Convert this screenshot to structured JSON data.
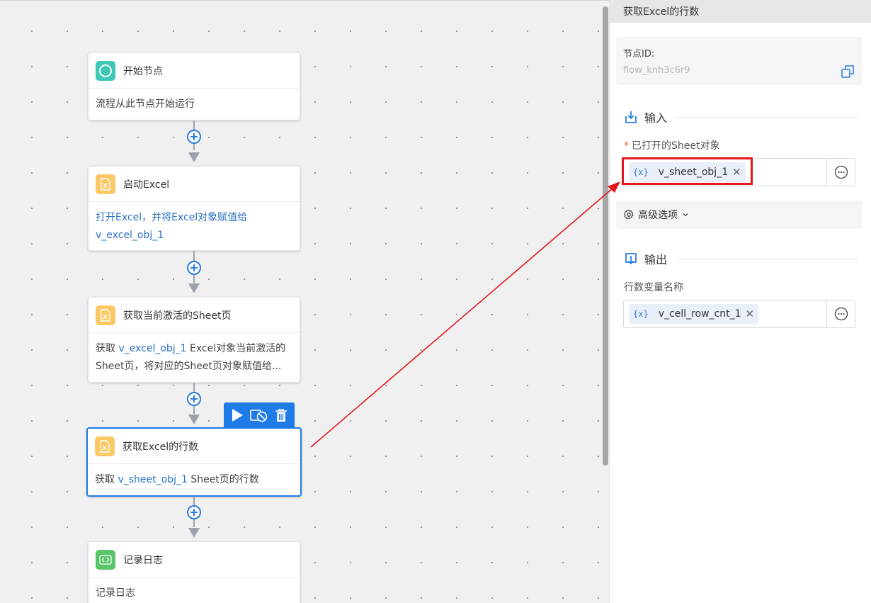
{
  "canvas": {
    "nodes": [
      {
        "title": "开始节点",
        "body_text": "流程从此节点开始运行"
      },
      {
        "title": "启动Excel",
        "body_prefix": "打开Excel，并将Excel对象赋值给",
        "body_var": "v_excel_obj_1"
      },
      {
        "title": "获取当前激活的Sheet页",
        "body_prefix": "获取 ",
        "body_var": "v_excel_obj_1",
        "body_suffix": " Excel对象当前激活的",
        "body_line2": "Sheet页，将对应的Sheet页对象赋值给..."
      },
      {
        "title": "获取Excel的行数",
        "body_prefix": "获取 ",
        "body_var": "v_sheet_obj_1",
        "body_suffix": " Sheet页的行数"
      },
      {
        "title": "记录日志",
        "body_text": "记录日志"
      }
    ],
    "toolbar": {
      "run_icon": "play-icon",
      "disable_icon": "disable-icon",
      "delete_icon": "trash-icon"
    }
  },
  "panel": {
    "header_title": "获取Excel的行数",
    "node_id_label": "节点ID:",
    "node_id_value": "flow_knh3c6r9",
    "input_section": "输入",
    "sheet_field_required": "*",
    "sheet_field_label": "已打开的Sheet对象",
    "sheet_var_brace": "{x}",
    "sheet_var": "v_sheet_obj_1",
    "advanced_label": "高级选项",
    "output_section": "输出",
    "row_var_label": "行数变量名称",
    "row_var_brace": "{x}",
    "row_var": "v_cell_row_cnt_1"
  },
  "colors": {
    "accent": "#1f7be8",
    "highlight": "#e5161c",
    "start_icon": "#3cc8b5",
    "excel_icon": "#fcc865",
    "log_icon": "#5ac568"
  }
}
